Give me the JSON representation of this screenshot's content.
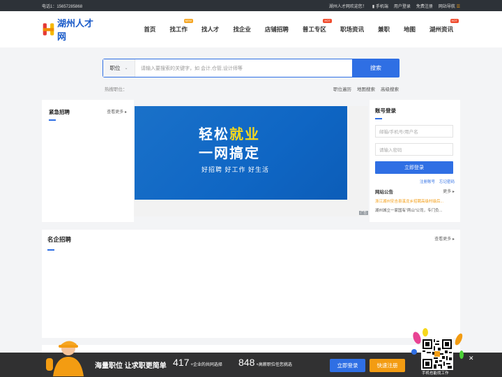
{
  "topbar": {
    "phone": "电话1：15657285868",
    "welcome": "湖州人才网欢迎您！",
    "links": [
      "手机端",
      "用户登录",
      "免费注册",
      "网站导航"
    ]
  },
  "header": {
    "logo_text": "湖州人才网",
    "nav": [
      {
        "label": "首页",
        "badge": ""
      },
      {
        "label": "找工作",
        "badge": "NEW"
      },
      {
        "label": "找人才",
        "badge": ""
      },
      {
        "label": "找企业",
        "badge": ""
      },
      {
        "label": "店铺招聘",
        "badge": ""
      },
      {
        "label": "普工专区",
        "badge": "HOT"
      },
      {
        "label": "职场资讯",
        "badge": ""
      },
      {
        "label": "兼职",
        "badge": ""
      },
      {
        "label": "地图",
        "badge": ""
      },
      {
        "label": "湖州资讯",
        "badge": "HOT"
      }
    ]
  },
  "search": {
    "type_label": "职位",
    "placeholder": "请输入要搜索的关键字，如 会计,仓管,设计师等",
    "button": "搜索",
    "hot_label": "热搜职位：",
    "links": [
      "职位遍历",
      "地图搜索",
      "高级搜索"
    ]
  },
  "urgent": {
    "title": "紧急招聘",
    "more": "查看更多"
  },
  "banner": {
    "line1_a": "轻松",
    "line1_b": "就业",
    "line2": "一网搞定",
    "tagline": "好招聘  好工作  好生活",
    "ad_tag": "广告"
  },
  "login": {
    "title": "账号登录",
    "user_placeholder": "邮箱/手机号/用户名",
    "pass_placeholder": "请输入密码",
    "button": "立即登录",
    "register": "注册账号",
    "forgot": "忘记密码",
    "notice_title": "网站公告",
    "notice_more": "更多",
    "notices": [
      "浙江湖州安吉县溪龙乡招聘高级村级后...",
      "湖州城立一家国有“两山”公司，专门负..."
    ]
  },
  "famous": {
    "title": "名企招聘",
    "more": "查看更多"
  },
  "bottombar": {
    "slogan": "海量职位 让求职更简单",
    "num1": "417",
    "num1_sub": "+企业的共同选择",
    "num2": "848",
    "num2_sub": "+高薪职位任您挑选",
    "login": "立即登录",
    "register": "快速注册",
    "qr_caption": "手机也能找工作",
    "close": "✕"
  },
  "colors": {
    "primary": "#2f6fe4",
    "orange": "#f39c12",
    "hot": "#f04b2d"
  }
}
